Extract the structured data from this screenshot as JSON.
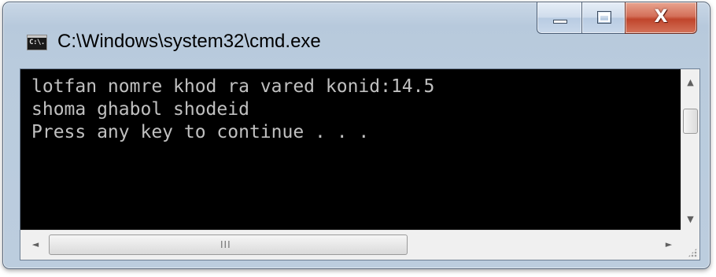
{
  "window": {
    "title": "C:\\Windows\\system32\\cmd.exe",
    "icon": "cmd-app-icon",
    "icon_text": "C:\\."
  },
  "caption_buttons": {
    "minimize_icon": "minimize-icon",
    "maximize_icon": "maximize-icon",
    "close_icon": "close-icon",
    "close_glyph": "X"
  },
  "console": {
    "background": "#000000",
    "foreground": "#c0c0c0",
    "lines": [
      "lotfan nomre khod ra vared konid:14.5",
      "shoma ghabol shodeid",
      "Press any key to continue . . ."
    ]
  },
  "scrollbars": {
    "up_arrow": "▲",
    "down_arrow": "▼",
    "left_arrow": "◄",
    "right_arrow": "►",
    "grip": "III"
  },
  "colors": {
    "close_button": "#c7503a",
    "frame": "#b9cbdd"
  }
}
